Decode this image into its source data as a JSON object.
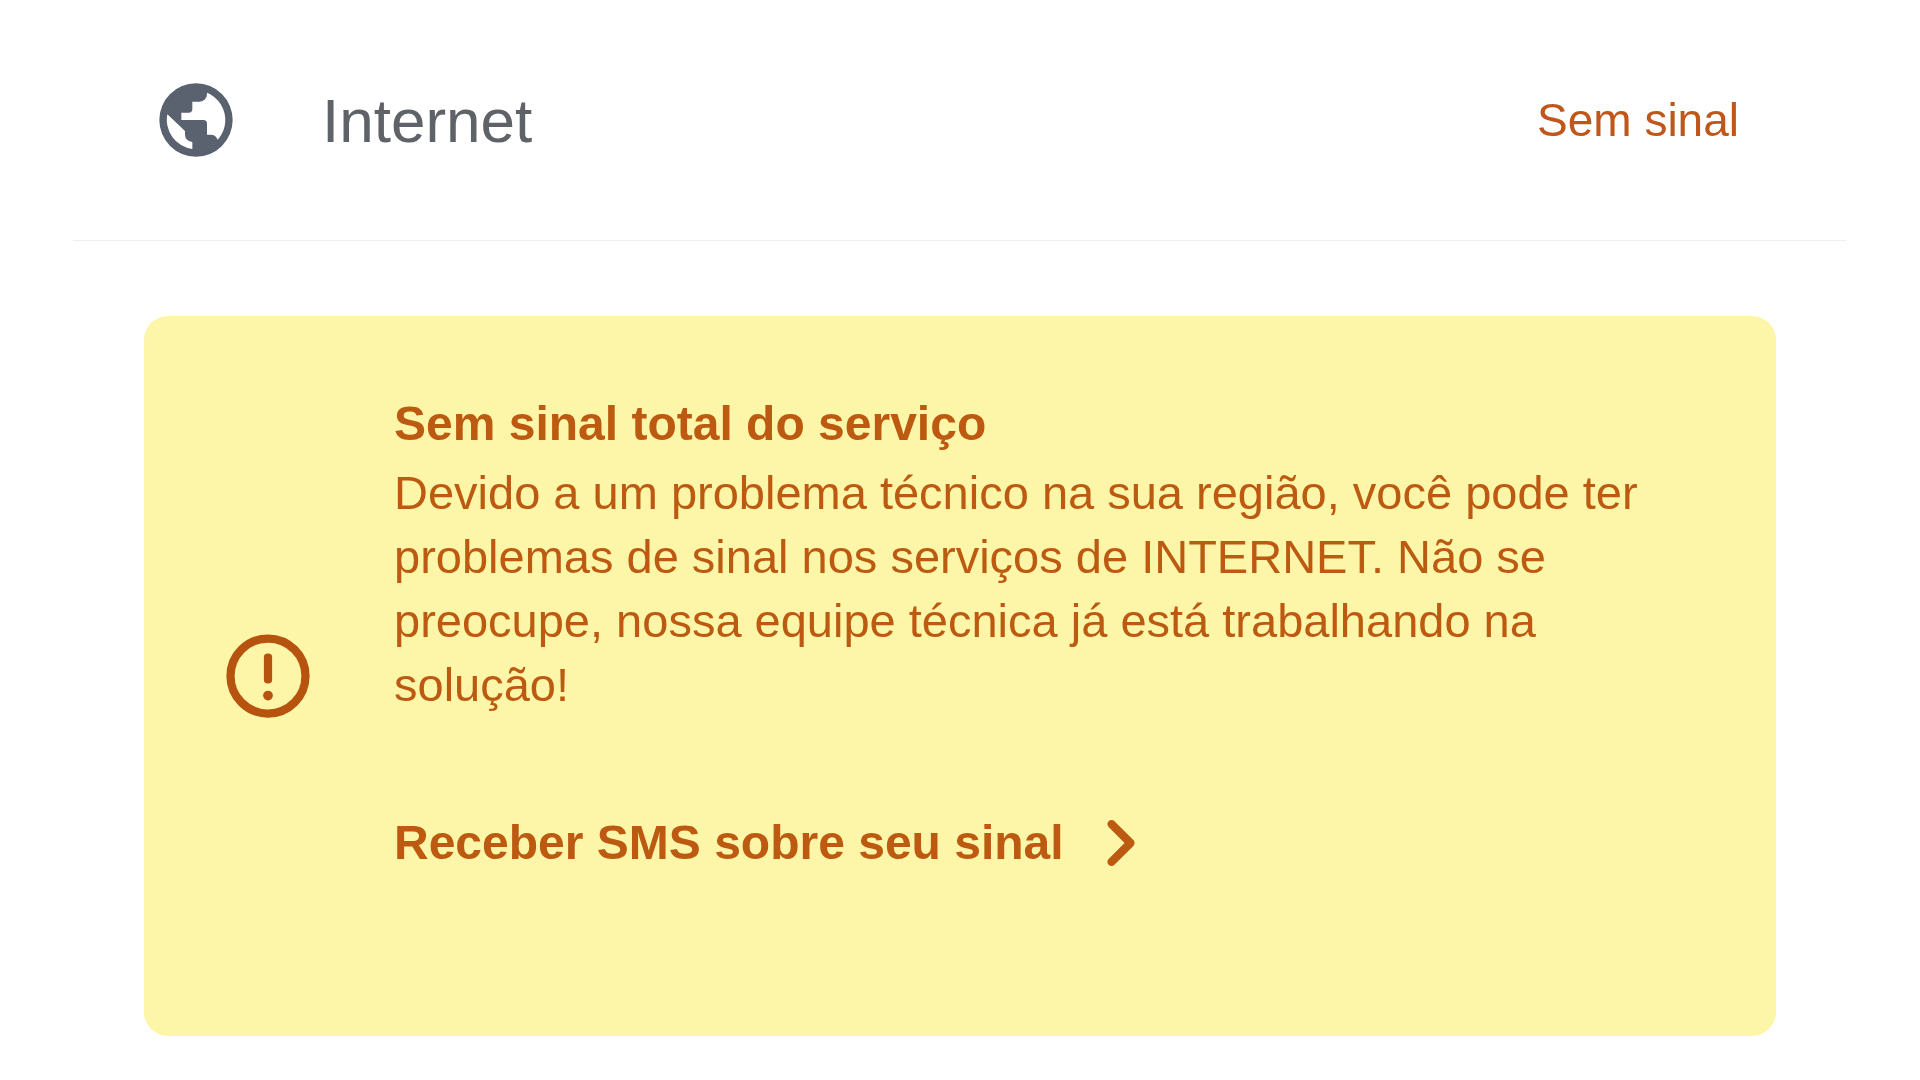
{
  "service": {
    "name": "Internet",
    "status": "Sem sinal"
  },
  "alert": {
    "title": "Sem sinal total do serviço",
    "message": "Devido a um problema técnico na sua região, você pode ter problemas de sinal nos serviços de INTERNET. Não se preocupe, nossa equipe técnica já está trabalhando na solução!",
    "action": "Receber SMS sobre seu sinal"
  }
}
